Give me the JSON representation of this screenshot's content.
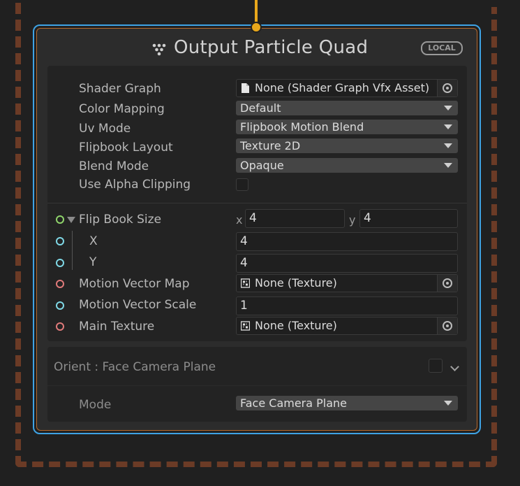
{
  "node": {
    "title": "Output Particle Quad",
    "badge": "LOCAL",
    "icon": "output-context-icon"
  },
  "settings": {
    "shader_graph": {
      "label": "Shader Graph",
      "value": "None (Shader Graph Vfx Asset)",
      "icon": "file-icon"
    },
    "color_mapping": {
      "label": "Color Mapping",
      "value": "Default"
    },
    "uv_mode": {
      "label": "Uv Mode",
      "value": "Flipbook Motion Blend"
    },
    "flipbook_layout": {
      "label": "Flipbook Layout",
      "value": "Texture 2D"
    },
    "blend_mode": {
      "label": "Blend Mode",
      "value": "Opaque"
    },
    "use_alpha_clipping": {
      "label": "Use Alpha Clipping",
      "checked": false
    }
  },
  "inputs": {
    "flip_book_size": {
      "label": "Flip Book Size",
      "x_axis": "x",
      "x_value": "4",
      "y_axis": "y",
      "y_value": "4",
      "x": {
        "label": "X",
        "value": "4"
      },
      "y": {
        "label": "Y",
        "value": "4"
      }
    },
    "motion_vector_map": {
      "label": "Motion Vector Map",
      "value": "None (Texture)",
      "icon": "texture-icon"
    },
    "motion_vector_scale": {
      "label": "Motion Vector Scale",
      "value": "1"
    },
    "main_texture": {
      "label": "Main Texture",
      "value": "None (Texture)",
      "icon": "texture-icon"
    }
  },
  "orient_block": {
    "title": "Orient : Face Camera Plane",
    "enabled": false,
    "mode_label": "Mode",
    "mode_value": "Face Camera Plane"
  },
  "colors": {
    "selection": "#3ea3e5",
    "flow": "#e8a71b",
    "system_border": "#6b3b26",
    "port_float": "#7fd8e6",
    "port_vector": "#8fd46b",
    "port_texture": "#e07a7a"
  }
}
